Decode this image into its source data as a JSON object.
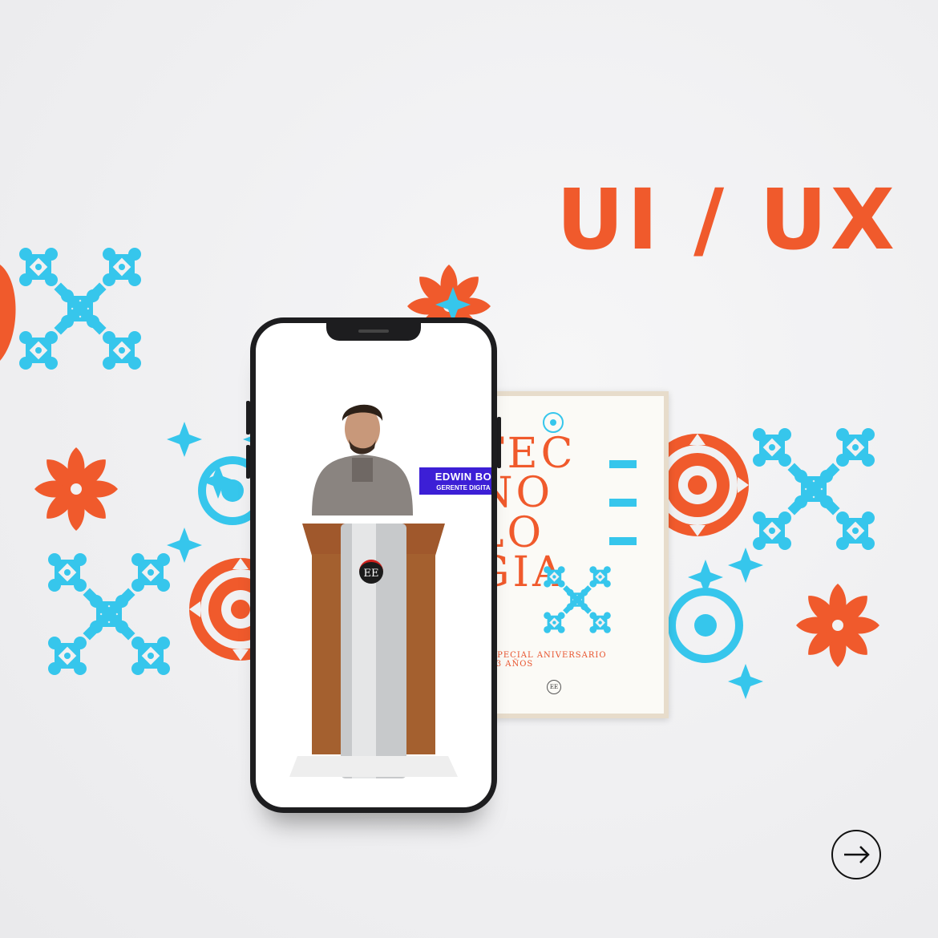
{
  "headline": "UI / UX",
  "colors": {
    "accent": "#f05a2c",
    "tile_blue": "#36c6ec",
    "phone_frame": "#1d1d1f",
    "nameplate": "#3c1fd6",
    "background": "#f1f1f2"
  },
  "phone_screen": {
    "speaker_name": "EDWIN BO",
    "speaker_title": "GERENTE DIGITA",
    "podium_logo": "EE"
  },
  "poster": {
    "word_lines": [
      "TEC",
      "NO",
      "LO",
      "GIA"
    ],
    "subtitle_line1": "ESPECIAL ANIVERSARIO",
    "subtitle_line2": "133 AÑOS",
    "logo": "EE"
  },
  "icons": {
    "next": "arrow-right-icon"
  }
}
